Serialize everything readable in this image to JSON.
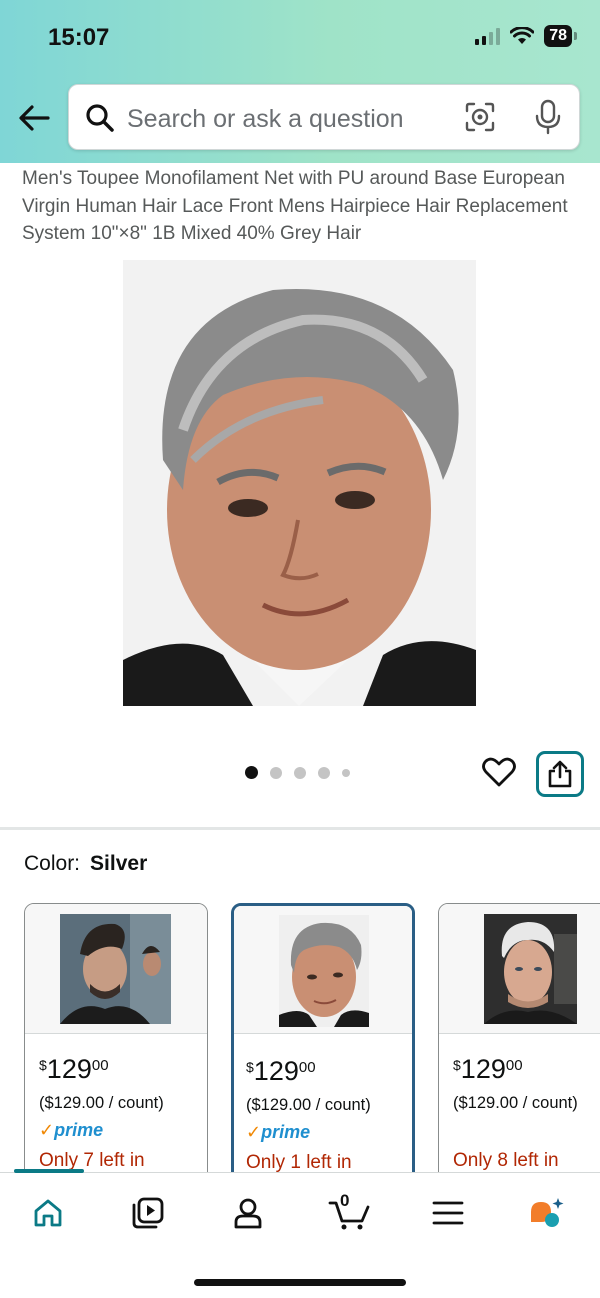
{
  "status_bar": {
    "time": "15:07",
    "battery": "78"
  },
  "search": {
    "placeholder": "Search or ask a question"
  },
  "product": {
    "title": "Men's Toupee Monofilament Net with PU around Base European Virgin Human Hair Lace Front Mens Hairpiece Hair Replacement System 10\"×8\" 1B Mixed 40% Grey Hair"
  },
  "gallery": {
    "image_count": 5,
    "active_index": 0
  },
  "color": {
    "label": "Color:",
    "value": "Silver"
  },
  "swatches": [
    {
      "price_symbol": "$",
      "price_whole": "129",
      "price_cents": "00",
      "unit_price": "($129.00 / count)",
      "prime": "prime",
      "stock": "Only 7 left in",
      "selected": false
    },
    {
      "price_symbol": "$",
      "price_whole": "129",
      "price_cents": "00",
      "unit_price": "($129.00 / count)",
      "prime": "prime",
      "stock": "Only 1 left in",
      "selected": true
    },
    {
      "price_symbol": "$",
      "price_whole": "129",
      "price_cents": "00",
      "unit_price": "($129.00 / count)",
      "prime": "",
      "stock": "Only 8 left in",
      "selected": false
    }
  ],
  "cart": {
    "count": "0"
  },
  "colors": {
    "accent": "#0b7a86",
    "price_red": "#b12704",
    "prime_blue": "#1f8fcf",
    "selected_border": "#2a5e85"
  }
}
